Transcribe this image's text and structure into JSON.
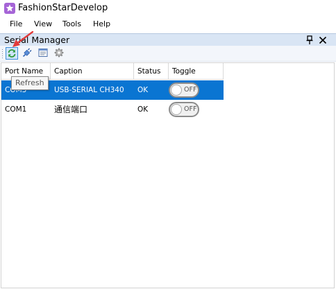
{
  "window": {
    "title": "FashionStarDevelop"
  },
  "menu": {
    "items": [
      "File",
      "View",
      "Tools",
      "Help"
    ]
  },
  "panel": {
    "title": "Serial Manager",
    "pin_icon": "pin-icon",
    "close_icon": "close-icon"
  },
  "toolbar": {
    "buttons": [
      {
        "name": "refresh-icon",
        "active": true
      },
      {
        "name": "plug-icon",
        "active": false
      },
      {
        "name": "port-settings-icon",
        "active": false
      },
      {
        "name": "gear-icon",
        "active": false
      }
    ],
    "tooltip": "Refresh"
  },
  "table": {
    "headers": [
      "Port Name",
      "Caption",
      "Status",
      "Toggle"
    ],
    "rows": [
      {
        "port": "COM3",
        "caption": "USB-SERIAL CH340",
        "status": "OK",
        "toggle": "OFF",
        "selected": true
      },
      {
        "port": "COM1",
        "caption": "通信端口",
        "status": "OK",
        "toggle": "OFF",
        "selected": false
      }
    ]
  },
  "colors": {
    "selection": "#0a75d2",
    "panel_header": "#d9e5f4",
    "arrow": "#e23b3b",
    "app_icon": "#a564d6"
  }
}
